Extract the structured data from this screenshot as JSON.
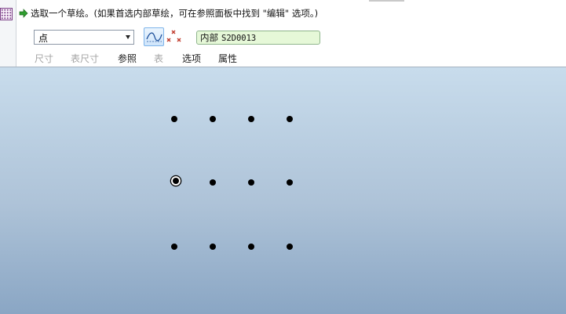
{
  "prompt": {
    "text": "选取一个草绘。(如果首选内部草绘，可在参照面板中找到 \"编辑\" 选项。)"
  },
  "dashboard": {
    "type_select": {
      "value": "点"
    },
    "sketch_field": {
      "label": "内部",
      "value": "S2D0013"
    },
    "tabs": [
      {
        "label": "尺寸",
        "enabled": false
      },
      {
        "label": "表尺寸",
        "enabled": false
      },
      {
        "label": "参照",
        "enabled": true
      },
      {
        "label": "表",
        "enabled": false
      },
      {
        "label": "选项",
        "enabled": true
      },
      {
        "label": "属性",
        "enabled": true
      }
    ]
  },
  "icons": {
    "sketch_icon": "grid-sketch-icon",
    "prompt_arrow": "green-arrow-icon",
    "spline_tool": "spline-curve-icon",
    "point_tool": "cross-points-icon"
  },
  "colors": {
    "prompt_arrow": "#2f9e2f",
    "sketch_field_bg": "#e6f8d8",
    "canvas_top": "#c8dcec",
    "canvas_bottom": "#8aa6c4",
    "point_marker": "#c0392b"
  }
}
